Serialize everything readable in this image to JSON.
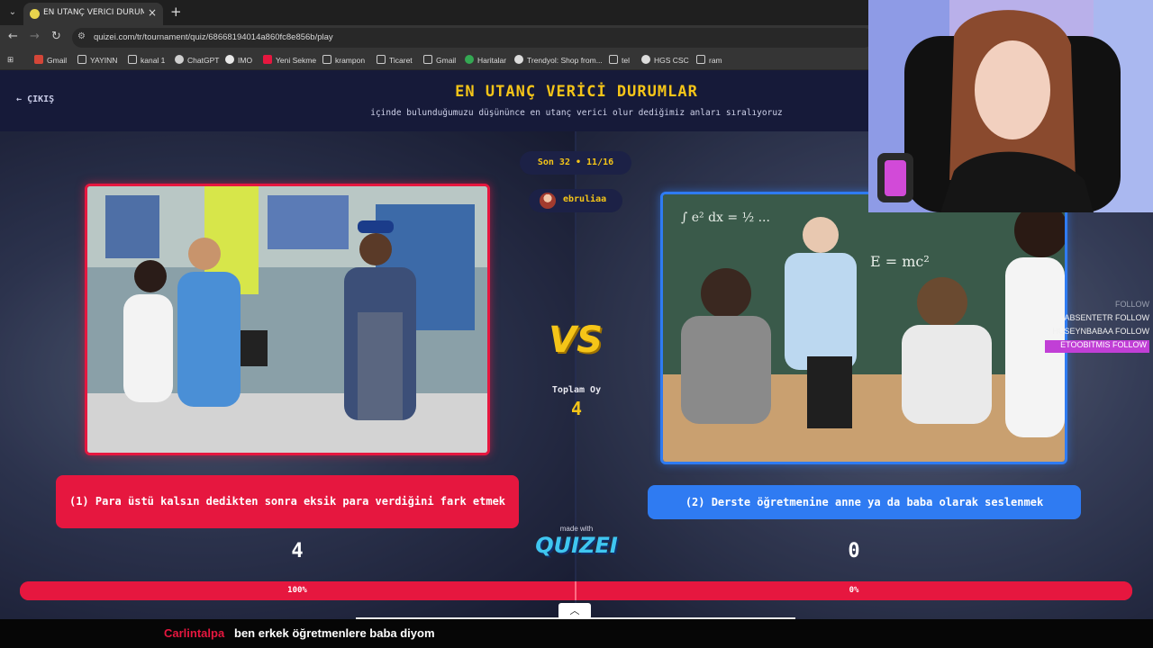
{
  "browser": {
    "tab_title": "EN UTANÇ VERİCİ DURUMLAR",
    "url": "quizei.com/tr/tournament/quiz/68668194014a860fc8e856b/play",
    "bookmarks": [
      "Gmail",
      "YAYINN",
      "kanal 1",
      "ChatGPT",
      "IMO",
      "Yeni Sekme",
      "krampon",
      "Ticaret",
      "Gmail",
      "Haritalar",
      "Trendyol: Shop from...",
      "tel",
      "HGS CSC",
      "ram"
    ]
  },
  "header": {
    "exit_label": "ÇIKIŞ",
    "title": "EN UTANÇ VERİCİ DURUMLAR",
    "subtitle": "içinde bulunduğumuzu düşününce en utanç verici olur dediğimiz anları sıralıyoruz"
  },
  "round": {
    "label": "Son 32 • 11/16"
  },
  "user": {
    "name": "ebruliaa"
  },
  "vs_label": "VS",
  "total": {
    "label": "Toplam Oy",
    "value": "4"
  },
  "left": {
    "answer": "(1) Para üstü kalsın dedikten sonra eksik para verdiğini fark etmek",
    "score": "4",
    "percent_label": "100%",
    "color": "#e6173f"
  },
  "right": {
    "answer": "(2) Derste öğretmenine anne ya da baba olarak seslenmek",
    "score": "0",
    "percent_label": "0%",
    "color": "#2f7bf2"
  },
  "progress": {
    "left_fraction": 1.0
  },
  "footer": {
    "made_with": "made with",
    "brand": "QUIZEI"
  },
  "stream": {
    "chat_user": "Carlintalpa",
    "chat_message": "ben erkek öğretmenlere baba diyom",
    "follows": [
      {
        "name": "FOLLOW",
        "highlight": false
      },
      {
        "name": "ABSENTETR  FOLLOW",
        "highlight": false
      },
      {
        "name": "HUSEYNBABAA  FOLLOW",
        "highlight": false
      },
      {
        "name": "ETOOBITMIS  FOLLOW",
        "highlight": true
      }
    ]
  }
}
